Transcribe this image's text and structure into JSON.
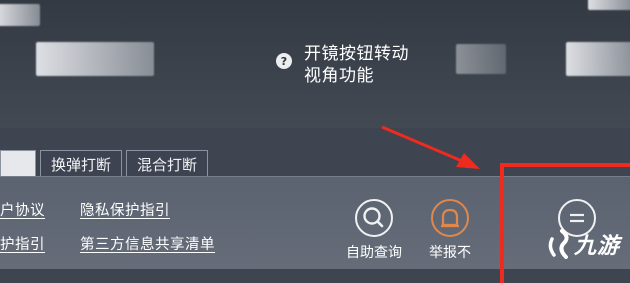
{
  "hint": {
    "text_line1": "开镜按钮转动",
    "text_line2": "视角功能",
    "icon_glyph": "?"
  },
  "tabs": [
    {
      "label": ""
    },
    {
      "label": "换弹打断"
    },
    {
      "label": "混合打断"
    }
  ],
  "links": {
    "user_agreement": "户协议",
    "privacy_guide": "隐私保护指引",
    "protection_guide": "护指引",
    "third_party_list": "第三方信息共享清单"
  },
  "actions": {
    "self_help": "自助查询",
    "report": "举报不"
  },
  "logo": {
    "text": "九游"
  },
  "colors": {
    "annotation_red": "#ef2a1e",
    "report_orange": "#e2874a"
  }
}
